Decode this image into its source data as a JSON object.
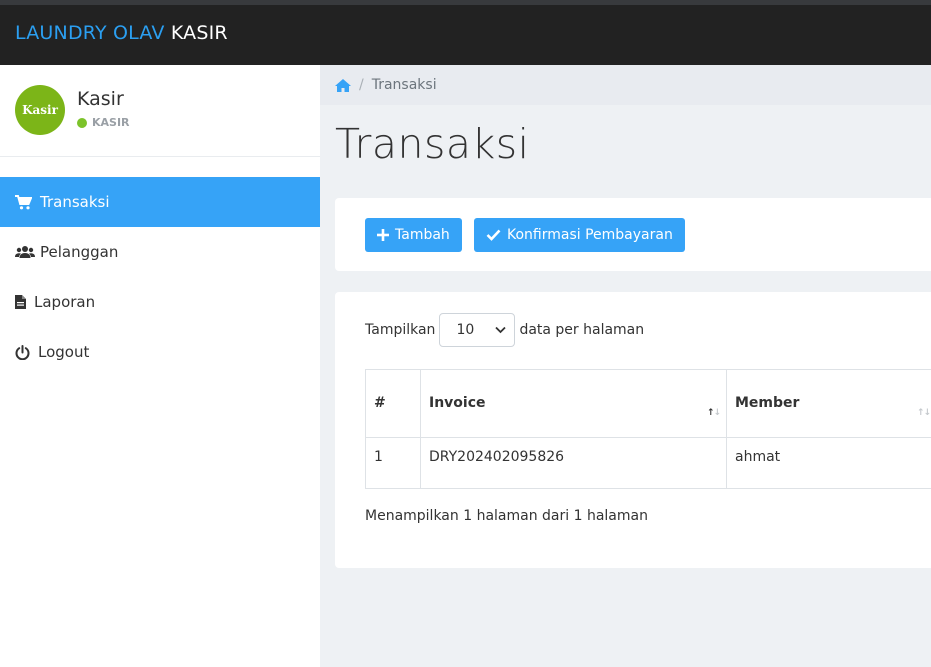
{
  "brand": {
    "part1": "LAUNDRY OLAV",
    "part2": "KASIR"
  },
  "profile": {
    "avatar_text": "Kasir",
    "name": "Kasir",
    "role": "KASIR"
  },
  "menu": [
    {
      "label": "Transaksi",
      "icon": "cart-icon",
      "active": true
    },
    {
      "label": "Pelanggan",
      "icon": "users-icon"
    },
    {
      "label": "Laporan",
      "icon": "file-icon"
    },
    {
      "label": "Logout",
      "icon": "power-icon"
    }
  ],
  "breadcrumb": {
    "home_icon": "home-icon",
    "current": "Transaksi"
  },
  "page": {
    "title": "Transaksi"
  },
  "actions": {
    "add_label": "Tambah",
    "confirm_label": "Konfirmasi Pembayaran"
  },
  "table": {
    "length_prefix": "Tampilkan",
    "length_value": "10",
    "length_suffix": "data per halaman",
    "columns": [
      "#",
      "Invoice",
      "Member"
    ],
    "rows": [
      {
        "no": "1",
        "invoice": "DRY202402095826",
        "member": "ahmat"
      }
    ],
    "info": "Menampilkan 1 halaman dari 1 halaman"
  },
  "colors": {
    "accent": "#36a3f7",
    "brand_blue": "#2b9ff1",
    "topbar": "#222222",
    "status_online": "#7cc32a",
    "avatar_bg": "#7cb518"
  }
}
